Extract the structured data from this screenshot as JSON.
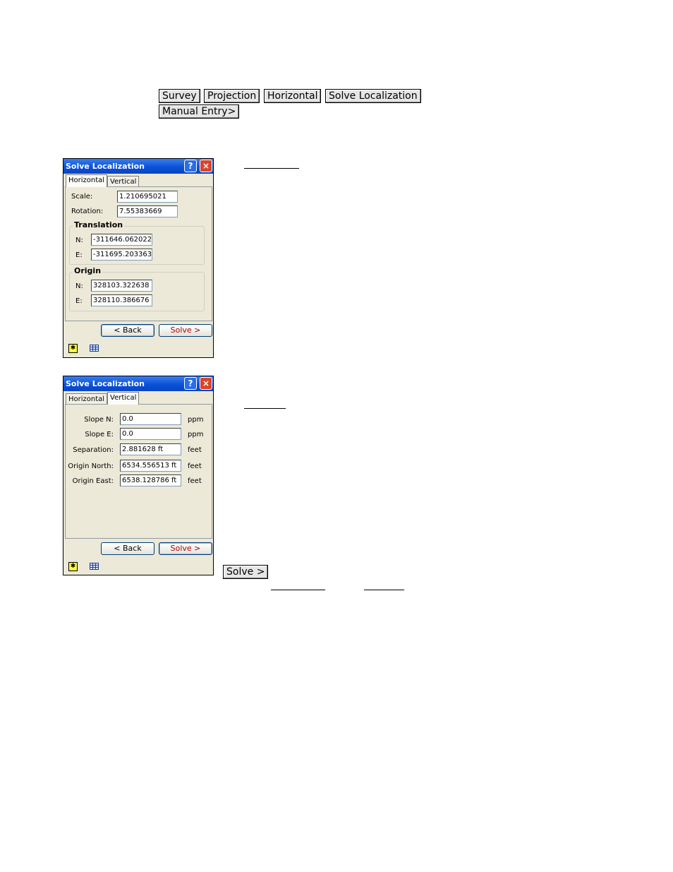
{
  "nav_path": {
    "buttons": [
      "Survey",
      "Projection",
      "Horizontal",
      "Solve Localization",
      "Manual Entry>"
    ]
  },
  "solve_button_label": "Solve >",
  "dialog_horizontal": {
    "title": "Solve Localization",
    "help_icon": "?",
    "close_icon": "×",
    "tabs": [
      "Horizontal",
      "Vertical"
    ],
    "active_tab": "Horizontal",
    "scale_label": "Scale:",
    "scale_value": "1.210695021",
    "rotation_label": "Rotation:",
    "rotation_value": "7.55383669",
    "translation": {
      "title": "Translation",
      "n_label": "N:",
      "n_value": "-311646.062022",
      "e_label": "E:",
      "e_value": "-311695.203363"
    },
    "origin": {
      "title": "Origin",
      "n_label": "N:",
      "n_value": "328103.322638",
      "e_label": "E:",
      "e_value": "328110.386676"
    },
    "back_label": "< Back",
    "solve_label": "Solve >",
    "footer_icons": [
      "star-icon",
      "grid-icon"
    ]
  },
  "dialog_vertical": {
    "title": "Solve Localization",
    "help_icon": "?",
    "close_icon": "×",
    "tabs": [
      "Horizontal",
      "Vertical"
    ],
    "active_tab": "Vertical",
    "rows": [
      {
        "label": "Slope N:",
        "value": "0.0",
        "unit": "ppm"
      },
      {
        "label": "Slope E:",
        "value": "0.0",
        "unit": "ppm"
      },
      {
        "label": "Separation:",
        "value": "2.881628 ft",
        "unit": "feet"
      },
      {
        "label": "Origin North:",
        "value": "6534.556513 ft",
        "unit": "feet"
      },
      {
        "label": "Origin East:",
        "value": "6538.128786 ft",
        "unit": "feet"
      }
    ],
    "back_label": "< Back",
    "solve_label": "Solve >",
    "footer_icons": [
      "star-icon",
      "grid-icon"
    ]
  }
}
